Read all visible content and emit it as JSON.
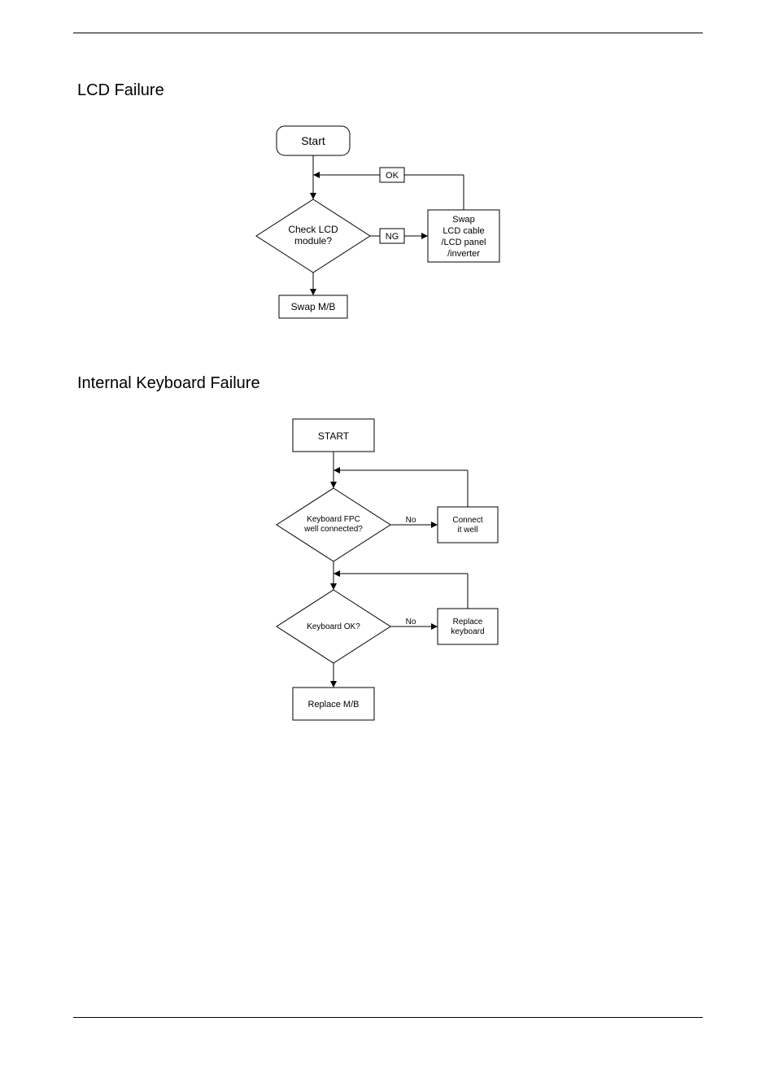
{
  "headings": {
    "h1": "LCD Failure",
    "h2": "Internal Keyboard Failure"
  },
  "chart_data": [
    {
      "type": "flowchart",
      "title": "LCD Failure",
      "nodes": [
        {
          "id": "start",
          "kind": "terminator",
          "label": "Start"
        },
        {
          "id": "check_lcd",
          "kind": "decision",
          "label": "Check LCD module?"
        },
        {
          "id": "swap_mb",
          "kind": "process",
          "label": "Swap M/B"
        },
        {
          "id": "swap_parts",
          "kind": "process",
          "label": "Swap LCD cable /LCD panel /inverter"
        }
      ],
      "edges": [
        {
          "from": "start",
          "to": "check_lcd",
          "label": ""
        },
        {
          "from": "check_lcd",
          "to": "swap_parts",
          "label": "NG"
        },
        {
          "from": "swap_parts",
          "to": "start",
          "label": "OK",
          "note": "feedback above start-to-check edge"
        },
        {
          "from": "check_lcd",
          "to": "swap_mb",
          "label": ""
        }
      ]
    },
    {
      "type": "flowchart",
      "title": "Internal Keyboard Failure",
      "nodes": [
        {
          "id": "start2",
          "kind": "terminator",
          "label": "START"
        },
        {
          "id": "fpc",
          "kind": "decision",
          "label": "Keyboard FPC well connected?"
        },
        {
          "id": "connect",
          "kind": "process",
          "label": "Connect it well"
        },
        {
          "id": "kbd_ok",
          "kind": "decision",
          "label": "Keyboard OK?"
        },
        {
          "id": "replace_k",
          "kind": "process",
          "label": "Replace keyboard"
        },
        {
          "id": "replace_m",
          "kind": "process",
          "label": "Replace M/B"
        }
      ],
      "edges": [
        {
          "from": "start2",
          "to": "fpc",
          "label": ""
        },
        {
          "from": "fpc",
          "to": "connect",
          "label": "No"
        },
        {
          "from": "connect",
          "to": "fpc",
          "label": "",
          "note": "feedback"
        },
        {
          "from": "fpc",
          "to": "kbd_ok",
          "label": ""
        },
        {
          "from": "kbd_ok",
          "to": "replace_k",
          "label": "No"
        },
        {
          "from": "replace_k",
          "to": "kbd_ok",
          "label": "",
          "note": "feedback"
        },
        {
          "from": "kbd_ok",
          "to": "replace_m",
          "label": ""
        }
      ]
    }
  ],
  "labels": {
    "lcd": {
      "start": "Start",
      "check1": "Check LCD",
      "check2": "module?",
      "ok": "OK",
      "ng": "NG",
      "swap1": "Swap",
      "swap2": "LCD cable",
      "swap3": "/LCD panel",
      "swap4": "/inverter",
      "swapmb": "Swap M/B"
    },
    "kbd": {
      "start": "START",
      "fpc1": "Keyboard FPC",
      "fpc2": "well connected?",
      "no": "No",
      "conn1": "Connect",
      "conn2": "it well",
      "ok": "Keyboard OK?",
      "rk1": "Replace",
      "rk2": "keyboard",
      "rmb": "Replace M/B"
    }
  }
}
